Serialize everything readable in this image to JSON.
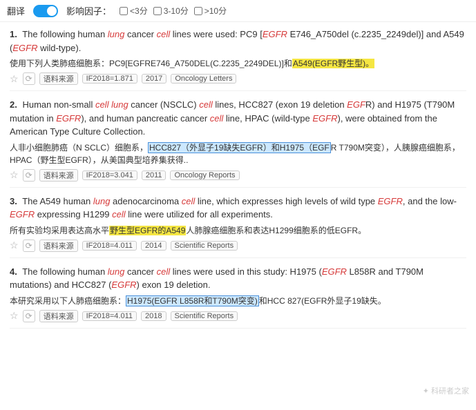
{
  "topbar": {
    "translate_label": "翻译",
    "impact_label": "影响因子：",
    "filters": [
      {
        "label": "<3分",
        "checked": false
      },
      {
        "label": "3-10分",
        "checked": false
      },
      {
        "label": ">10分",
        "checked": false
      }
    ]
  },
  "results": [
    {
      "number": "1.",
      "en_parts": [
        {
          "text": "The following human "
        },
        {
          "text": "lung",
          "style": "italic"
        },
        {
          "text": " cancer "
        },
        {
          "text": "cell",
          "style": "italic"
        },
        {
          "text": " lines were used: PC9 ["
        },
        {
          "text": "EGFR",
          "style": "italic-red"
        },
        {
          "text": " E746_A750del (c.2235_2249del)] and A549 ("
        },
        {
          "text": "EGFR",
          "style": "italic-red"
        },
        {
          "text": " wild-type)."
        }
      ],
      "zh_parts": [
        {
          "text": "使用下列人类肺癌细胞系：PC9[EGFRE746_A750DEL(C.2235_2249DEL)]和"
        },
        {
          "text": "A549(EGFR野生型)。",
          "style": "highlight-yellow"
        }
      ],
      "meta": {
        "if": "IF2018=1.871",
        "year": "2017",
        "journal": "Oncology Letters"
      }
    },
    {
      "number": "2.",
      "en_parts": [
        {
          "text": "Human non-small "
        },
        {
          "text": "cell",
          "style": "italic"
        },
        {
          "text": " "
        },
        {
          "text": "lung",
          "style": "italic"
        },
        {
          "text": " cancer (NSCLC) "
        },
        {
          "text": "cell",
          "style": "italic"
        },
        {
          "text": " lines, HCC827 (exon 19 deletion "
        },
        {
          "text": "EGF",
          "style": "italic-red"
        },
        {
          "text": "R) and H1975 (T790M mutation in "
        },
        {
          "text": "EGFR",
          "style": "italic-red"
        },
        {
          "text": "), and human pancreatic cancer "
        },
        {
          "text": "cell",
          "style": "italic"
        },
        {
          "text": " line, HPAC (wild-type "
        },
        {
          "text": "EGFR",
          "style": "italic-red"
        },
        {
          "text": "), were obtained from the American Type Culture Collection."
        }
      ],
      "zh_parts": [
        {
          "text": "人非小细胞肺癌（N SCLC）细胞系，"
        },
        {
          "text": "HCC827（外显子19缺失EGFR）和H1975（EGF",
          "style": "highlight-blue"
        },
        {
          "text": "R T790M突变），人胰腺癌细胞系，HPAC（野生型EGFR），从美国典型培养集获得.."
        }
      ],
      "meta": {
        "if": "IF2018=3.041",
        "year": "2011",
        "journal": "Oncology Reports"
      }
    },
    {
      "number": "3.",
      "en_parts": [
        {
          "text": "The A549 human "
        },
        {
          "text": "lung",
          "style": "italic"
        },
        {
          "text": " adenocarcinoma "
        },
        {
          "text": "cell",
          "style": "italic"
        },
        {
          "text": " line, which expresses high levels of wild type "
        },
        {
          "text": "EGFR",
          "style": "italic-red"
        },
        {
          "text": ", and the low-"
        },
        {
          "text": "EGFR",
          "style": "italic-red"
        },
        {
          "text": " expressing H1299 "
        },
        {
          "text": "cell",
          "style": "italic"
        },
        {
          "text": " line were utilized for all experiments."
        }
      ],
      "zh_parts": [
        {
          "text": "所有实验均采用表达高水平"
        },
        {
          "text": "野生型EGFR的A549",
          "style": "highlight-yellow"
        },
        {
          "text": "人肺腺癌细胞系和表达H1299细胞系的低EGFR。"
        }
      ],
      "meta": {
        "if": "IF2018=4.011",
        "year": "2014",
        "journal": "Scientific Reports"
      }
    },
    {
      "number": "4.",
      "en_parts": [
        {
          "text": "The following human "
        },
        {
          "text": "lung",
          "style": "italic"
        },
        {
          "text": " cancer "
        },
        {
          "text": "cell",
          "style": "italic"
        },
        {
          "text": " lines were used in this study: H1975 ("
        },
        {
          "text": "EGFR",
          "style": "italic-red"
        },
        {
          "text": " L858R and T790M mutations) and HCC827 ("
        },
        {
          "text": "EGFR",
          "style": "italic-red"
        },
        {
          "text": ") exon 19 deletion."
        }
      ],
      "zh_parts": [
        {
          "text": "本研究采用以下人肺癌细胞系："
        },
        {
          "text": "H1975(EGFR L858R和T790M突变)",
          "style": "highlight-blue"
        },
        {
          "text": "和HCC 827(EGFR外显子19缺失。"
        }
      ],
      "meta": {
        "if": "IF2018=4.011",
        "year": "2018",
        "journal": "Scientific Reports"
      }
    }
  ],
  "watermark": "科研者之家"
}
